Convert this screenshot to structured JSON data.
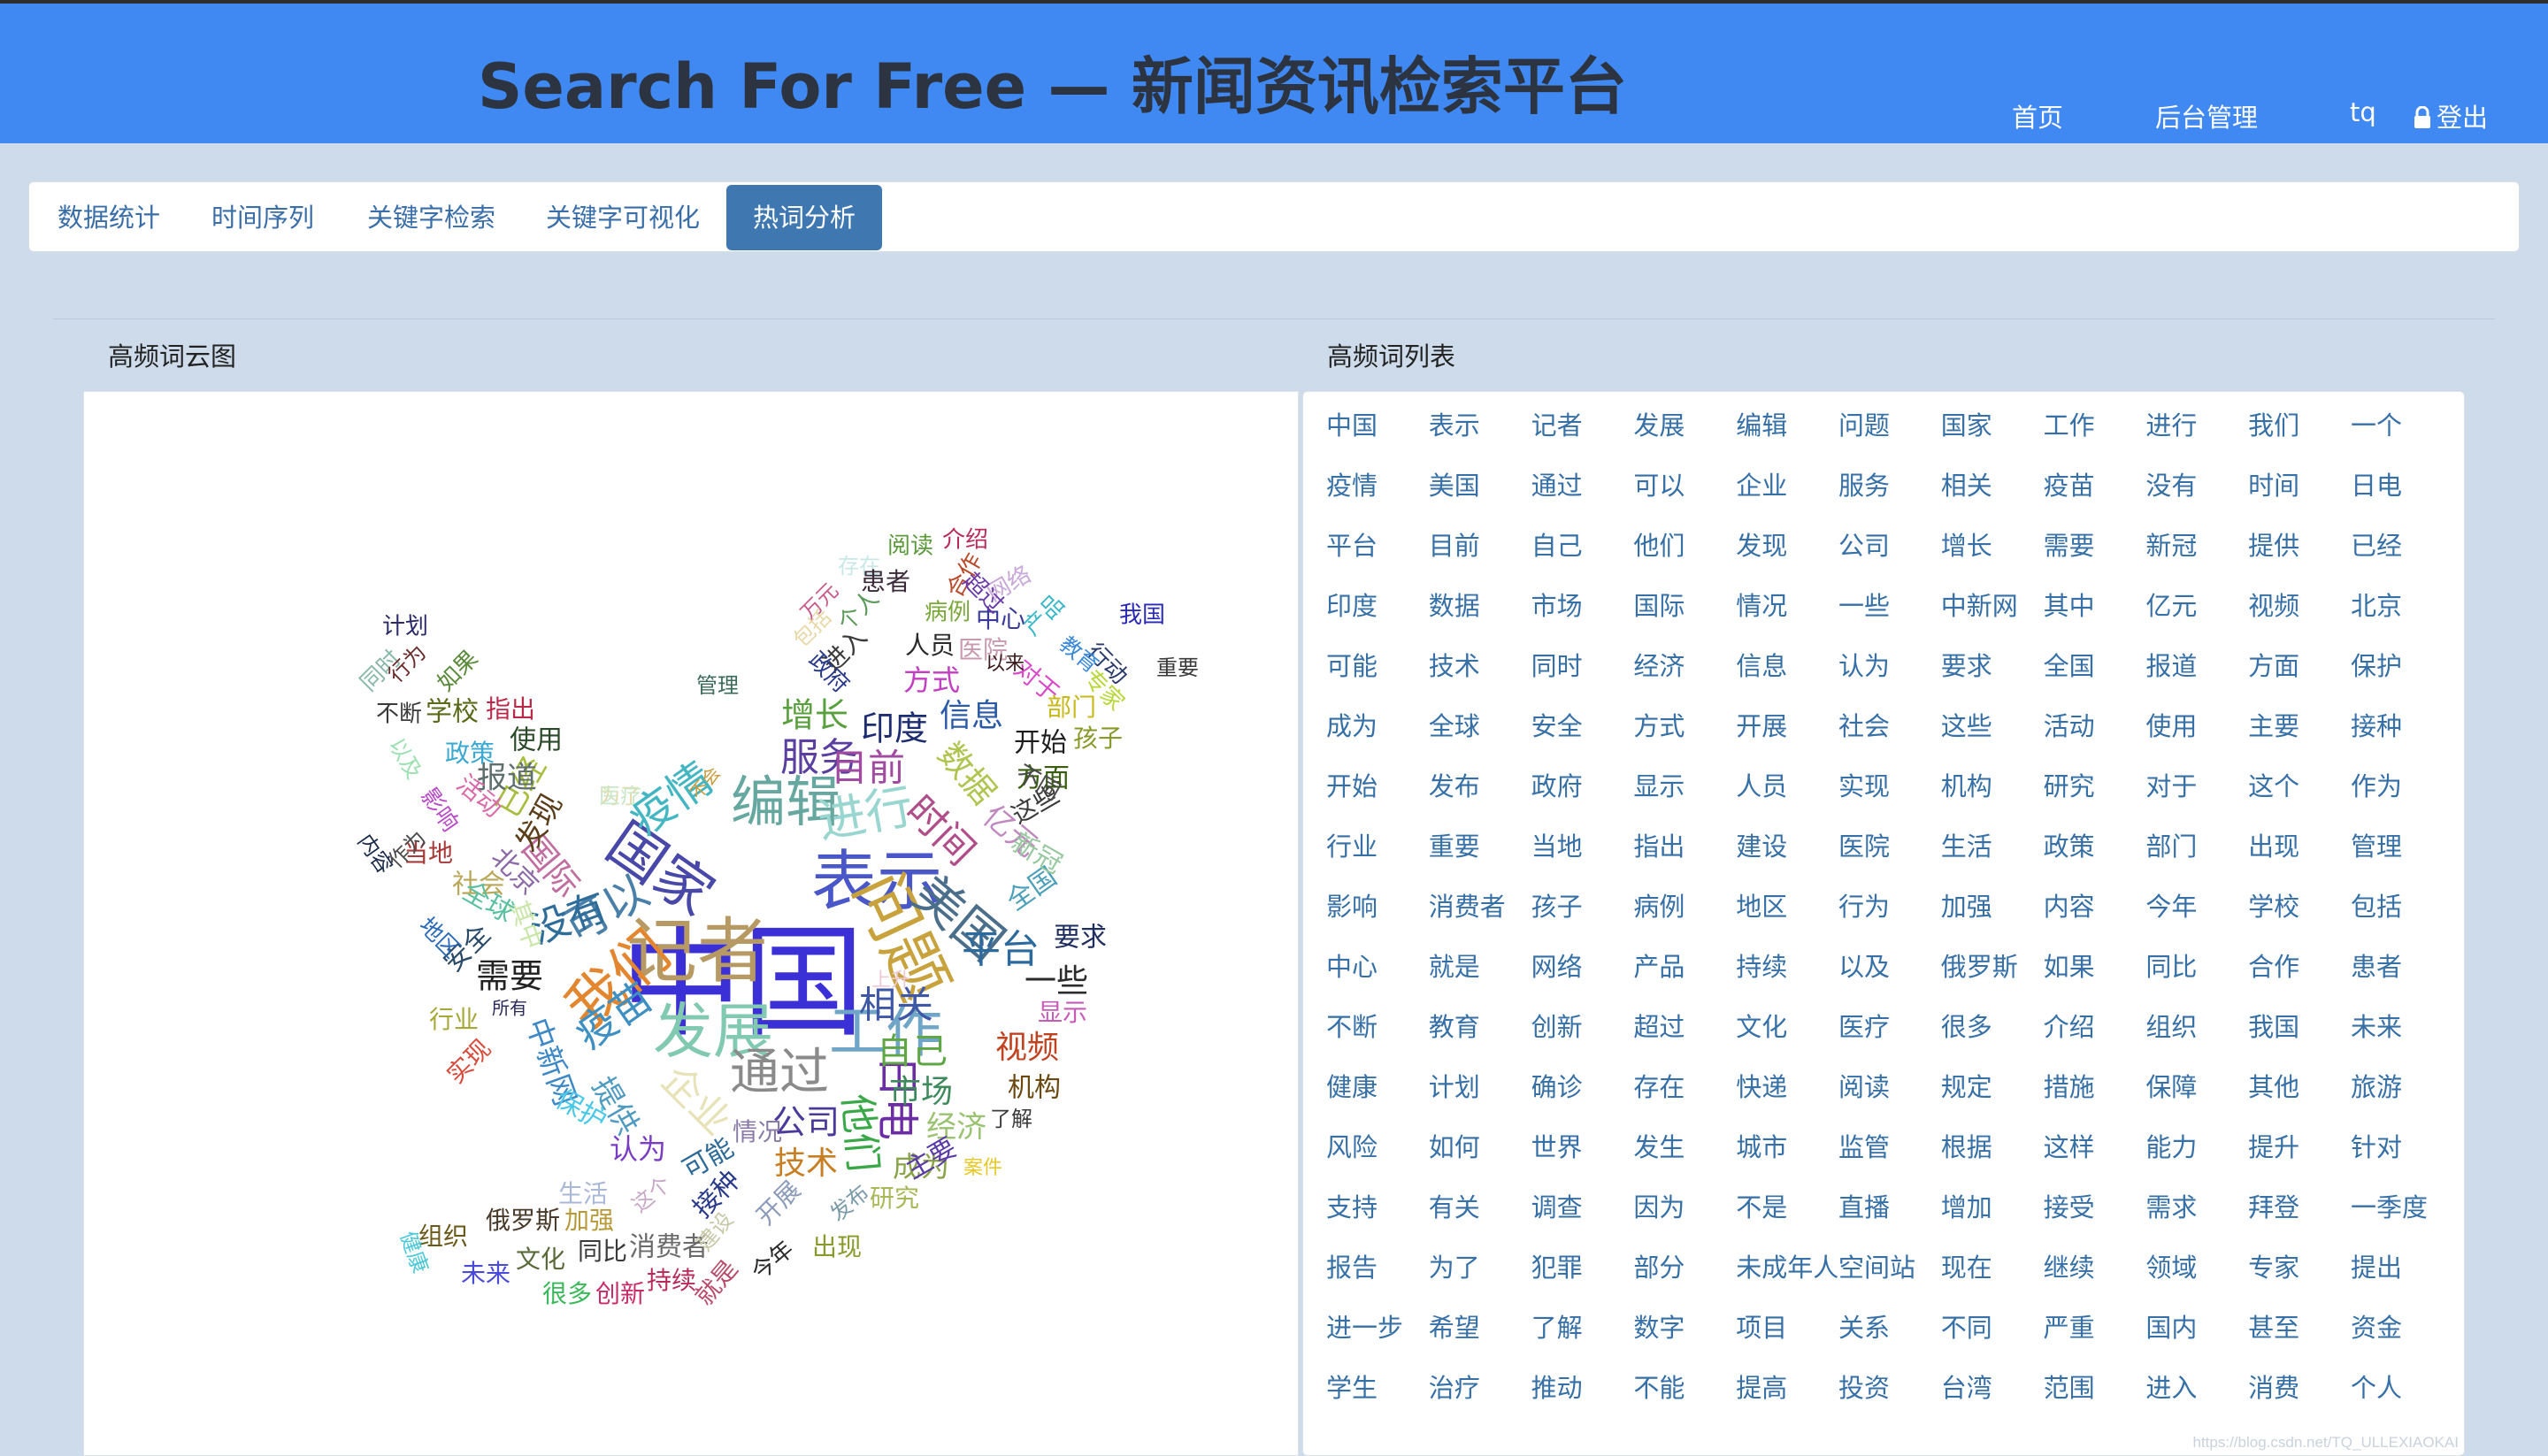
{
  "header": {
    "title": "Search For Free — 新闻资讯检索平台",
    "nav": [
      "首页",
      "后台管理",
      "tq"
    ],
    "logout_label": "登出"
  },
  "tabs": [
    "数据统计",
    "时间序列",
    "关键字检索",
    "关键字可视化",
    "热词分析"
  ],
  "active_tab": 4,
  "sections": {
    "cloud_title": "高频词云图",
    "list_title": "高频词列表"
  },
  "cloud_words": [
    {
      "t": "中国",
      "c": "#3b2fd6"
    },
    {
      "t": "表示",
      "c": "#4a57c8"
    },
    {
      "t": "记者",
      "c": "#b79a63"
    },
    {
      "t": "发展",
      "c": "#82c9b2"
    },
    {
      "t": "问题",
      "c": "#c8a23c"
    },
    {
      "t": "国家",
      "c": "#4848a8"
    },
    {
      "t": "工作",
      "c": "#6fa6c8"
    },
    {
      "t": "我们",
      "c": "#e2862f"
    },
    {
      "t": "编辑",
      "c": "#66a8a0"
    },
    {
      "t": "进行",
      "c": "#9ad6d0"
    },
    {
      "t": "通过",
      "c": "#8a8a8a"
    },
    {
      "t": "美国",
      "c": "#4b6e8a"
    },
    {
      "t": "疫情",
      "c": "#44b6c2"
    },
    {
      "t": "平台",
      "c": "#2c6a9e"
    },
    {
      "t": "日电",
      "c": "#6b2ca6"
    },
    {
      "t": "企业",
      "c": "#e8e2b8"
    },
    {
      "t": "服务",
      "c": "#5b3fa0"
    },
    {
      "t": "可以",
      "c": "#4a7fa8"
    },
    {
      "t": "时间",
      "c": "#b04e8a"
    },
    {
      "t": "没有",
      "c": "#2e6c9a"
    },
    {
      "t": "相关",
      "c": "#3e58a6"
    },
    {
      "t": "他们",
      "c": "#3aa848"
    },
    {
      "t": "疫苗",
      "c": "#3e90c2"
    },
    {
      "t": "目前",
      "c": "#a04aa0"
    },
    {
      "t": "自己",
      "c": "#5fa645"
    },
    {
      "t": "需要",
      "c": "#222222"
    },
    {
      "t": "一些",
      "c": "#2b2b2b"
    },
    {
      "t": "视频",
      "c": "#c04422"
    },
    {
      "t": "市场",
      "c": "#3e8a5c"
    },
    {
      "t": "公司",
      "c": "#4b3a9a"
    },
    {
      "t": "增长",
      "c": "#5aa03e"
    },
    {
      "t": "印度",
      "c": "#1e2c70"
    },
    {
      "t": "数据",
      "c": "#b0c450"
    },
    {
      "t": "已经",
      "c": "#a8be40"
    },
    {
      "t": "提供",
      "c": "#4e9ac0"
    },
    {
      "t": "机构",
      "c": "#6a4a10"
    },
    {
      "t": "中新网",
      "c": "#3e88c6"
    },
    {
      "t": "国际",
      "c": "#c06ea0"
    },
    {
      "t": "发现",
      "c": "#5a3e1a"
    },
    {
      "t": "报道",
      "c": "#5e6f6e"
    },
    {
      "t": "技术",
      "c": "#c87e22"
    },
    {
      "t": "经济",
      "c": "#9ac270"
    },
    {
      "t": "信息",
      "c": "#2a5aa8"
    },
    {
      "t": "亿元",
      "c": "#c08ac0"
    },
    {
      "t": "方式",
      "c": "#c23ec2"
    },
    {
      "t": "成为",
      "c": "#8aa44a"
    },
    {
      "t": "认为",
      "c": "#7a3ec4"
    },
    {
      "t": "可能",
      "c": "#2e6a98"
    },
    {
      "t": "主要",
      "c": "#5a3aa6"
    },
    {
      "t": "北京",
      "c": "#8b6aa6"
    },
    {
      "t": "全国",
      "c": "#4aa0b8"
    },
    {
      "t": "新冠",
      "c": "#98c8a0"
    },
    {
      "t": "开始",
      "c": "#1e1e1e"
    },
    {
      "t": "方面",
      "c": "#3a5e10"
    },
    {
      "t": "使用",
      "c": "#2a4a2a"
    },
    {
      "t": "学校",
      "c": "#5a6a1a"
    },
    {
      "t": "指出",
      "c": "#b82a4a"
    },
    {
      "t": "政策",
      "c": "#3aa8d0"
    },
    {
      "t": "活动",
      "c": "#d86aa8"
    },
    {
      "t": "当地",
      "c": "#a83a3a"
    },
    {
      "t": "社会",
      "c": "#b8a858"
    },
    {
      "t": "其中",
      "c": "#c8e6a8"
    },
    {
      "t": "安全",
      "c": "#2a4a6a"
    },
    {
      "t": "全球",
      "c": "#5abfa0"
    },
    {
      "t": "行业",
      "c": "#a8a838"
    },
    {
      "t": "显示",
      "c": "#c85ab8"
    },
    {
      "t": "要求",
      "c": "#1e2e5e"
    },
    {
      "t": "部门",
      "c": "#c8b818"
    },
    {
      "t": "孩子",
      "c": "#8a9a2a"
    },
    {
      "t": "人员",
      "c": "#2a2a2a"
    },
    {
      "t": "中心",
      "c": "#3a3a9a"
    },
    {
      "t": "医院",
      "c": "#c89ab0"
    },
    {
      "t": "对于",
      "c": "#d84ac8"
    },
    {
      "t": "阅读",
      "c": "#5a9a3a"
    },
    {
      "t": "合作",
      "c": "#b84a2a"
    },
    {
      "t": "介绍",
      "c": "#b82a5a"
    },
    {
      "t": "病例",
      "c": "#7aa83a"
    },
    {
      "t": "我国",
      "c": "#2a2ab8"
    },
    {
      "t": "计划",
      "c": "#2a2a6a"
    },
    {
      "t": "如果",
      "c": "#5a8a3a"
    },
    {
      "t": "不断",
      "c": "#3a3a3a"
    },
    {
      "t": "以及",
      "c": "#9ae0b0"
    },
    {
      "t": "影响",
      "c": "#b84ac8"
    },
    {
      "t": "作为",
      "c": "#4a4a4a"
    },
    {
      "t": "地区",
      "c": "#2a6ab8"
    },
    {
      "t": "内容",
      "c": "#1a2a4a"
    },
    {
      "t": "实现",
      "c": "#d84a3a"
    },
    {
      "t": "保护",
      "c": "#4ac8e8"
    },
    {
      "t": "情况",
      "c": "#8a7aa8"
    },
    {
      "t": "接种",
      "c": "#2a3a8a"
    },
    {
      "t": "开展",
      "c": "#8a9ab8"
    },
    {
      "t": "研究",
      "c": "#a8b858"
    },
    {
      "t": "案件",
      "c": "#e8c828"
    },
    {
      "t": "了解",
      "c": "#3a3a3a"
    },
    {
      "t": "消费者",
      "c": "#6a6a6a"
    },
    {
      "t": "加强",
      "c": "#b89a3a"
    },
    {
      "t": "生活",
      "c": "#aab8d8"
    },
    {
      "t": "俄罗斯",
      "c": "#4a3a2a"
    },
    {
      "t": "组织",
      "c": "#6a5a1a"
    },
    {
      "t": "同比",
      "c": "#3a3a3a"
    },
    {
      "t": "文化",
      "c": "#5a6a3a"
    },
    {
      "t": "很多",
      "c": "#3ab85a"
    },
    {
      "t": "创新",
      "c": "#c82a6a"
    },
    {
      "t": "持续",
      "c": "#b82a5a"
    },
    {
      "t": "未来",
      "c": "#4a4ad8"
    },
    {
      "t": "健康",
      "c": "#4ac8d8"
    },
    {
      "t": "出现",
      "c": "#8a9a2a"
    },
    {
      "t": "今年",
      "c": "#2a2a2a"
    },
    {
      "t": "就是",
      "c": "#b84a6a"
    },
    {
      "t": "建设",
      "c": "#c8c8a8"
    },
    {
      "t": "这个",
      "c": "#c8a8c8"
    },
    {
      "t": "发布",
      "c": "#7a9aa8"
    },
    {
      "t": "所有",
      "c": "#2a2a5a"
    },
    {
      "t": "上升",
      "c": "#f0c8d8"
    },
    {
      "t": "这些",
      "c": "#3a3a3a"
    },
    {
      "t": "不同",
      "c": "#4a4a4a"
    },
    {
      "t": "不会",
      "c": "#c89a3a"
    },
    {
      "t": "重要",
      "c": "#3a3a3a"
    },
    {
      "t": "行动",
      "c": "#2a3a6a"
    },
    {
      "t": "专家",
      "c": "#b8d83a"
    },
    {
      "t": "教育",
      "c": "#3a88d8"
    },
    {
      "t": "产品",
      "c": "#3ab8c8"
    },
    {
      "t": "网络",
      "c": "#c8a8d8"
    },
    {
      "t": "超过",
      "c": "#6a3aa8"
    },
    {
      "t": "存在",
      "c": "#c8e8e8"
    },
    {
      "t": "患者",
      "c": "#3a2a3a"
    },
    {
      "t": "万元",
      "c": "#c85a8a"
    },
    {
      "t": "包括",
      "c": "#e8d8a8"
    },
    {
      "t": "个人",
      "c": "#5a9a5a"
    },
    {
      "t": "进入",
      "c": "#3a3a3a"
    },
    {
      "t": "管理",
      "c": "#3a6a5a"
    },
    {
      "t": "政府",
      "c": "#2a3a8a"
    },
    {
      "t": "以来",
      "c": "#3a1a1a"
    },
    {
      "t": "同时",
      "c": "#8ab8a8"
    },
    {
      "t": "行为",
      "c": "#6a2a2a"
    },
    {
      "t": "为了",
      "c": "#e8d8a8"
    },
    {
      "t": "医疗",
      "c": "#c8e8c8"
    }
  ],
  "word_list": [
    "中国",
    "表示",
    "记者",
    "发展",
    "编辑",
    "问题",
    "国家",
    "工作",
    "进行",
    "我们",
    "一个",
    "疫情",
    "美国",
    "通过",
    "可以",
    "企业",
    "服务",
    "相关",
    "疫苗",
    "没有",
    "时间",
    "日电",
    "平台",
    "目前",
    "自己",
    "他们",
    "发现",
    "公司",
    "增长",
    "需要",
    "新冠",
    "提供",
    "已经",
    "印度",
    "数据",
    "市场",
    "国际",
    "情况",
    "一些",
    "中新网",
    "其中",
    "亿元",
    "视频",
    "北京",
    "可能",
    "技术",
    "同时",
    "经济",
    "信息",
    "认为",
    "要求",
    "全国",
    "报道",
    "方面",
    "保护",
    "成为",
    "全球",
    "安全",
    "方式",
    "开展",
    "社会",
    "这些",
    "活动",
    "使用",
    "主要",
    "接种",
    "开始",
    "发布",
    "政府",
    "显示",
    "人员",
    "实现",
    "机构",
    "研究",
    "对于",
    "这个",
    "作为",
    "行业",
    "重要",
    "当地",
    "指出",
    "建设",
    "医院",
    "生活",
    "政策",
    "部门",
    "出现",
    "管理",
    "影响",
    "消费者",
    "孩子",
    "病例",
    "地区",
    "行为",
    "加强",
    "内容",
    "今年",
    "学校",
    "包括",
    "中心",
    "就是",
    "网络",
    "产品",
    "持续",
    "以及",
    "俄罗斯",
    "如果",
    "同比",
    "合作",
    "患者",
    "不断",
    "教育",
    "创新",
    "超过",
    "文化",
    "医疗",
    "很多",
    "介绍",
    "组织",
    "我国",
    "未来",
    "健康",
    "计划",
    "确诊",
    "存在",
    "快递",
    "阅读",
    "规定",
    "措施",
    "保障",
    "其他",
    "旅游",
    "风险",
    "如何",
    "世界",
    "发生",
    "城市",
    "监管",
    "根据",
    "这样",
    "能力",
    "提升",
    "针对",
    "支持",
    "有关",
    "调查",
    "因为",
    "不是",
    "直播",
    "增加",
    "接受",
    "需求",
    "拜登",
    "一季度",
    "报告",
    "为了",
    "犯罪",
    "部分",
    "未成年人",
    "空间站",
    "现在",
    "继续",
    "领域",
    "专家",
    "提出",
    "进一步",
    "希望",
    "了解",
    "数字",
    "项目",
    "关系",
    "不同",
    "严重",
    "国内",
    "甚至",
    "资金",
    "学生",
    "治疗",
    "推动",
    "不能",
    "提高",
    "投资",
    "台湾",
    "范围",
    "进入",
    "消费",
    "个人"
  ],
  "watermark": "https://blog.csdn.net/TQ_ULLEXIAOKAI",
  "colors": {
    "header_bg": "#4088f2",
    "page_bg": "#cddbea",
    "active_tab": "#3f78b1",
    "link": "#3670a6"
  }
}
